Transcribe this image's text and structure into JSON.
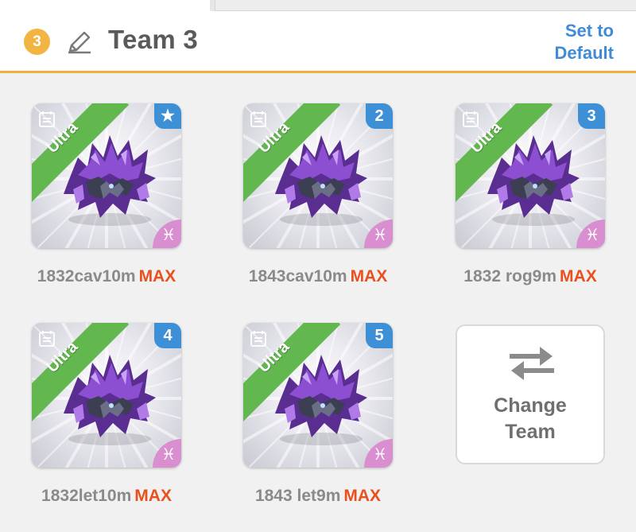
{
  "header": {
    "team_number": "3",
    "team_name": "Team 3",
    "set_default_label": "Set to\nDefault"
  },
  "team_slots": [
    {
      "grade": "Ultra",
      "position": "★",
      "name": "1832cav10m",
      "level": "MAX",
      "sign": "♓"
    },
    {
      "grade": "Ultra",
      "position": "2",
      "name": "1843cav10m",
      "level": "MAX",
      "sign": "♓"
    },
    {
      "grade": "Ultra",
      "position": "3",
      "name": "1832 rog9m",
      "level": "MAX",
      "sign": "♓"
    },
    {
      "grade": "Ultra",
      "position": "4",
      "name": "1832let10m",
      "level": "MAX",
      "sign": "♓"
    },
    {
      "grade": "Ultra",
      "position": "5",
      "name": "1843 let9m",
      "level": "MAX",
      "sign": "♓"
    }
  ],
  "change_team": {
    "label": "Change\nTeam",
    "icon": "swap-arrows-icon"
  },
  "colors": {
    "accent": "#f0b23c",
    "link": "#3f8bd6",
    "max": "#e8501d",
    "ultra_ribbon": "#62b84f",
    "position_badge": "#3d8fd6",
    "zodiac_badge": "#d98fcf"
  }
}
